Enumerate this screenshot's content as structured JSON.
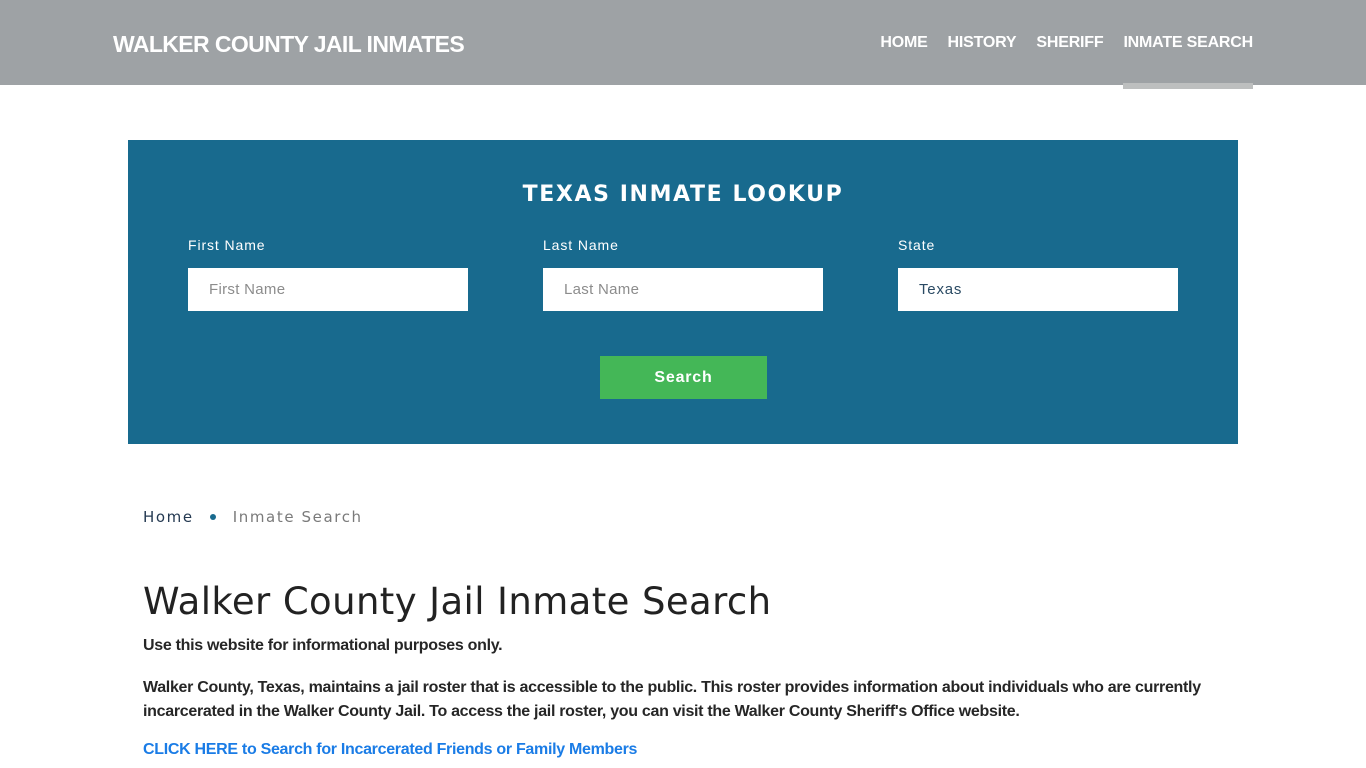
{
  "header": {
    "brand": "WALKER COUNTY JAIL INMATES",
    "nav": [
      {
        "label": "HOME",
        "active": false
      },
      {
        "label": "HISTORY",
        "active": false
      },
      {
        "label": "SHERIFF",
        "active": false
      },
      {
        "label": "INMATE SEARCH",
        "active": true
      }
    ]
  },
  "lookup": {
    "title": "TEXAS INMATE LOOKUP",
    "first_name": {
      "label": "First Name",
      "placeholder": "First Name",
      "value": ""
    },
    "last_name": {
      "label": "Last Name",
      "placeholder": "Last Name",
      "value": ""
    },
    "state": {
      "label": "State",
      "value": "Texas"
    },
    "search_label": "Search"
  },
  "breadcrumb": {
    "home": "Home",
    "current": "Inmate Search"
  },
  "content": {
    "title": "Walker County Jail Inmate Search",
    "disclaimer": "Use this website for informational purposes only.",
    "body": "Walker County, Texas, maintains a jail roster that is accessible to the public. This roster provides information about individuals who are currently incarcerated in the Walker County Jail. To access the jail roster, you can visit the Walker County Sheriff's Office website.",
    "cta": "CLICK HERE to Search for Incarcerated Friends or Family Members"
  },
  "colors": {
    "header_bg": "#9ea2a5",
    "active_underline": "#bdbfbf",
    "panel_bg": "#186a8e",
    "button_bg": "#44b757",
    "link": "#1a7ce6"
  }
}
